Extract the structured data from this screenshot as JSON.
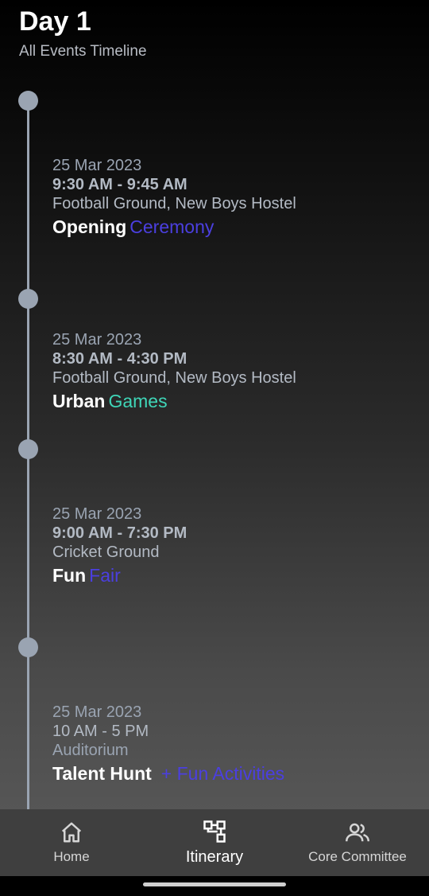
{
  "header": {
    "title": "Day 1",
    "subtitle": "All Events Timeline"
  },
  "events": [
    {
      "date": "25 Mar 2023",
      "time": "9:30 AM - 9:45 AM",
      "venue": "Football Ground, New Boys Hostel",
      "name_first": "Opening",
      "name_second": "Ceremony",
      "accent": "#4b3fe0"
    },
    {
      "date": "25 Mar 2023",
      "time": "8:30 AM - 4:30 PM",
      "venue": "Football Ground, New Boys Hostel",
      "name_first": "Urban",
      "name_second": "Games",
      "accent": "#3fd6b8"
    },
    {
      "date": "25 Mar 2023",
      "time": "9:00 AM - 7:30 PM",
      "venue": "Cricket Ground",
      "name_first": "Fun",
      "name_second": "Fair",
      "accent": "#4b3fe0"
    },
    {
      "date": "25 Mar 2023",
      "time": "10 AM - 5 PM",
      "venue": "Auditorium",
      "name_first": "Talent Hunt",
      "name_second": "+ Fun Activities",
      "accent": "#4b3fe0"
    }
  ],
  "nav": {
    "items": [
      {
        "label": "Home",
        "icon": "home-icon"
      },
      {
        "label": "Itinerary",
        "icon": "itinerary-icon"
      },
      {
        "label": "Core Committee",
        "icon": "people-icon"
      }
    ],
    "active": "Itinerary"
  }
}
